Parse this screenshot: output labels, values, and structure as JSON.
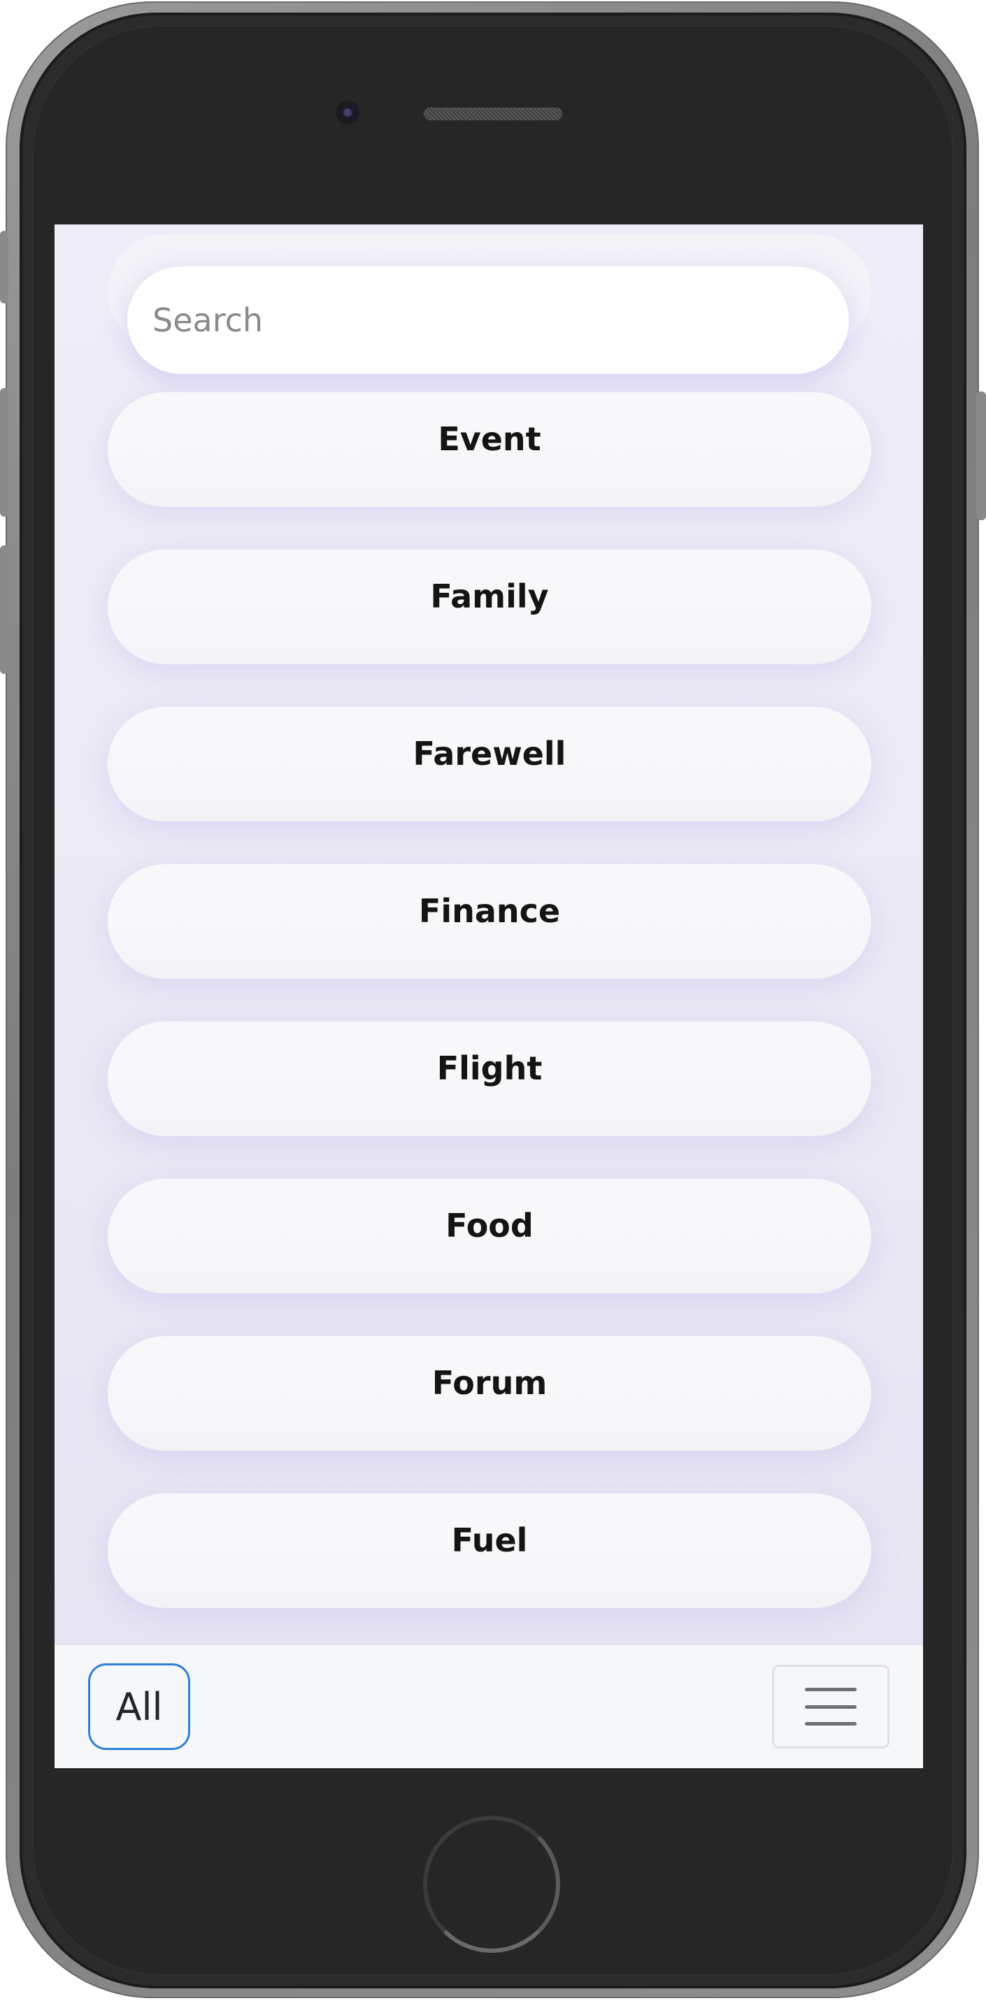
{
  "search": {
    "placeholder": "Search",
    "value": ""
  },
  "categories": [
    {
      "label": "Event"
    },
    {
      "label": "Family"
    },
    {
      "label": "Farewell"
    },
    {
      "label": "Finance"
    },
    {
      "label": "Flight"
    },
    {
      "label": "Food"
    },
    {
      "label": "Forum"
    },
    {
      "label": "Fuel"
    }
  ],
  "toolbar": {
    "all_label": "All",
    "menu_icon": "hamburger-icon"
  },
  "colors": {
    "accent": "#2f7fd8",
    "background": "#eeedf7",
    "card": "#f8f8fa",
    "toolbar": "#f6f7f9"
  }
}
